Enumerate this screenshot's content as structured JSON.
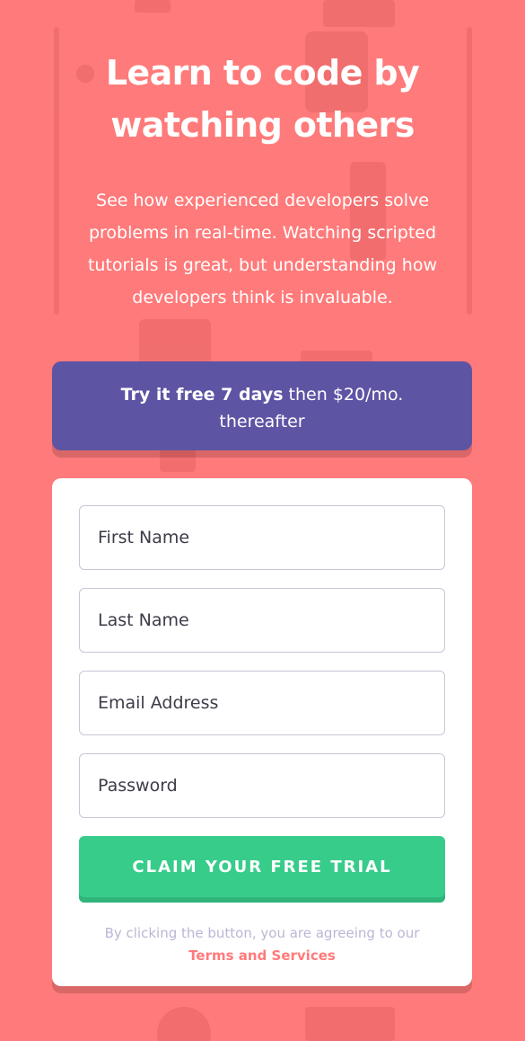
{
  "colors": {
    "background": "#ff7a7a",
    "promo_background": "#5e54a4",
    "card_background": "#ffffff",
    "cta_background": "#38cc8b",
    "terms_link": "#ff7a7a",
    "terms_text": "#bab7d4"
  },
  "hero": {
    "title_line1": "Learn to code by",
    "title_line2": "watching others",
    "description": "See how experienced developers solve problems in real-time. Watching scripted tutorials is great, but understanding how developers think is invaluable."
  },
  "promo": {
    "highlight": "Try it free 7 days",
    "text": " then $20/mo.",
    "text2": "thereafter"
  },
  "form": {
    "first_name": {
      "placeholder": "First Name",
      "value": ""
    },
    "last_name": {
      "placeholder": "Last Name",
      "value": ""
    },
    "email": {
      "placeholder": "Email Address",
      "value": ""
    },
    "password": {
      "placeholder": "Password",
      "value": ""
    },
    "submit_label": "CLAIM YOUR FREE TRIAL",
    "terms_prefix": "By clicking the button, you are agreeing to our",
    "terms_link": "Terms and Services"
  }
}
